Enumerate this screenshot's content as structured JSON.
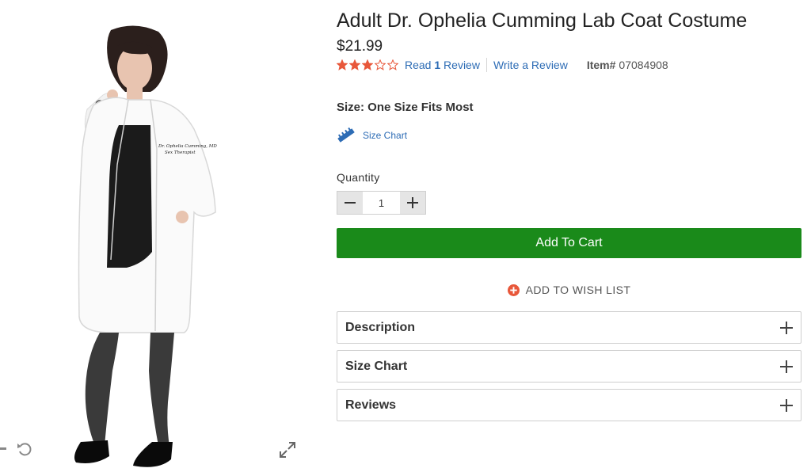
{
  "product": {
    "title": "Adult Dr. Ophelia Cumming Lab Coat Costume",
    "price": "$21.99",
    "rating": {
      "stars_filled": 3,
      "stars_total": 5
    },
    "reviews": {
      "read_prefix": "Read",
      "count": "1",
      "read_suffix": "Review",
      "write_label": "Write a Review"
    },
    "item_label": "Item#",
    "item_number": "07084908",
    "coat_embroidery_line1": "Dr. Ophelia Cumming, MD",
    "coat_embroidery_line2": "Sex Therapist"
  },
  "size": {
    "label": "Size: One Size Fits Most",
    "chart_link": "Size Chart"
  },
  "quantity": {
    "label": "Quantity",
    "value": "1"
  },
  "actions": {
    "add_to_cart": "Add To Cart",
    "wishlist": "ADD TO WISH LIST"
  },
  "accordions": [
    {
      "title": "Description"
    },
    {
      "title": "Size Chart"
    },
    {
      "title": "Reviews"
    }
  ],
  "colors": {
    "star": "#e8573a",
    "link": "#2d6cb5",
    "cart": "#1a8a1a",
    "wish": "#e8573a"
  },
  "icons": [
    "rotate-icon",
    "expand-icon",
    "ruler-icon",
    "minus-icon",
    "plus-icon",
    "add-circle-icon",
    "star-icon"
  ]
}
